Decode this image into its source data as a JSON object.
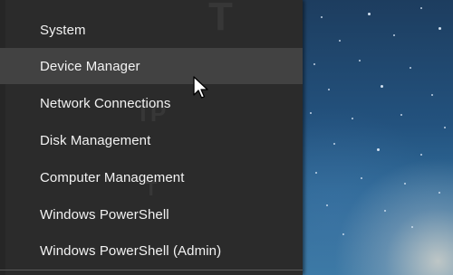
{
  "context_menu": {
    "items": [
      {
        "label": "System",
        "hovered": false
      },
      {
        "label": "Device Manager",
        "hovered": true
      },
      {
        "label": "Network Connections",
        "hovered": false
      },
      {
        "label": "Disk Management",
        "hovered": false
      },
      {
        "label": "Computer Management",
        "hovered": false
      },
      {
        "label": "Windows PowerShell",
        "hovered": false
      },
      {
        "label": "Windows PowerShell (Admin)",
        "hovered": false
      }
    ]
  },
  "colors": {
    "menu_background": "#2b2b2b",
    "hover_background": "#424242",
    "text": "#f2f2f2"
  },
  "icons": {
    "cursor": "mouse-pointer-icon"
  }
}
